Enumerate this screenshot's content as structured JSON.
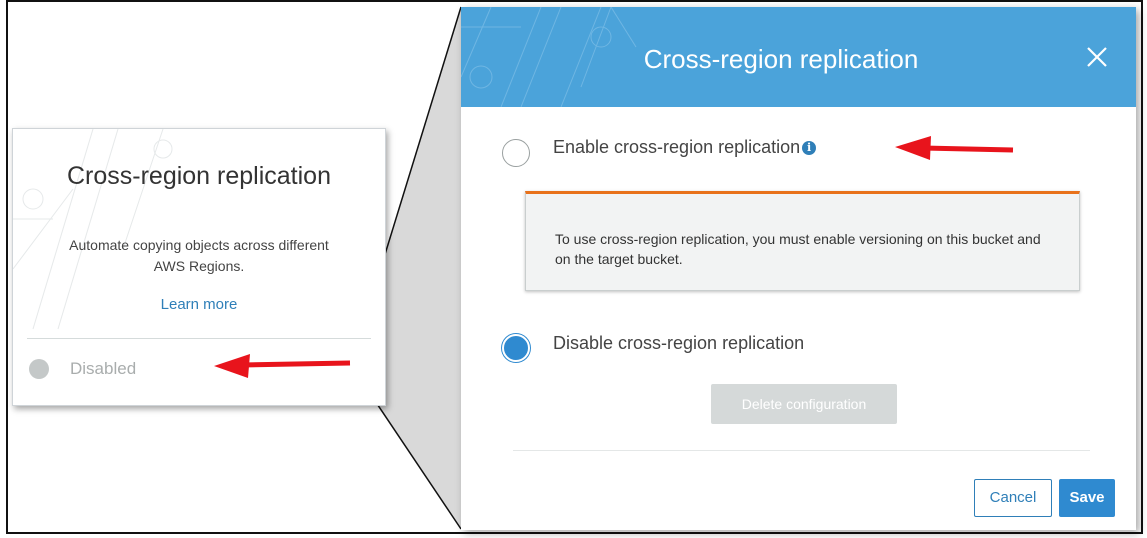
{
  "card": {
    "title": "Cross-region replication",
    "description": "Automate copying objects across different AWS Regions.",
    "learn_more": "Learn more",
    "status": "Disabled"
  },
  "modal": {
    "title": "Cross-region replication",
    "enable_label": "Enable cross-region replication",
    "notice": "To use cross-region replication, you must enable versioning on this bucket and on the target bucket.",
    "disable_label": "Disable cross-region replication",
    "selected_option": "disable",
    "delete_button": "Delete configuration",
    "cancel_button": "Cancel",
    "save_button": "Save"
  },
  "icons": {
    "close": "close-icon",
    "info": "info-icon",
    "status": "status-dot-icon",
    "annotation": "red-arrow"
  },
  "colors": {
    "header": "#4ba3da",
    "primary": "#2f8ad0",
    "link": "#2f7fb8",
    "warning_border": "#e8711a",
    "annotation": "#e8141c"
  }
}
